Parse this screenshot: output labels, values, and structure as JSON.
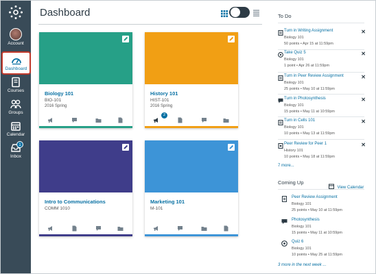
{
  "header": {
    "title": "Dashboard"
  },
  "nav": {
    "account": "Account",
    "dashboard": "Dashboard",
    "courses": "Courses",
    "groups": "Groups",
    "calendar": "Calendar",
    "inbox": "Inbox",
    "inbox_badge": "1"
  },
  "cards": [
    {
      "name": "Biology 101",
      "code": "BIO-101",
      "term": "2016 Spring",
      "color": "#26a087",
      "announcement_badge": ""
    },
    {
      "name": "History 101",
      "code": "HIST-101",
      "term": "2016 Spring",
      "color": "#f19f14",
      "announcement_badge": "2"
    },
    {
      "name": "Intro to Communications",
      "code": "COMM 1010",
      "term": "",
      "color": "#3f3d8a",
      "announcement_badge": ""
    },
    {
      "name": "Marketing 101",
      "code": "M-101",
      "term": "",
      "color": "#3d94d7",
      "announcement_badge": ""
    }
  ],
  "todo": {
    "heading": "To Do",
    "items": [
      {
        "title": "Turn in Writing Assignment",
        "course": "Biology 101",
        "details": "50 points • Apr 15 at 11:59pm",
        "icon": "assignment-icon"
      },
      {
        "title": "Take Quiz 5",
        "course": "Biology 101",
        "details": "1 point • Apr 26 at 11:59pm",
        "icon": "quiz-icon"
      },
      {
        "title": "Turn in Peer Review Assignment",
        "course": "Biology 101",
        "details": "25 points • May 10 at 11:59pm",
        "icon": "assignment-icon"
      },
      {
        "title": "Turn in Photosynthesis",
        "course": "Biology 101",
        "details": "15 points • May 11 at 10:59pm",
        "icon": "discussion-icon"
      },
      {
        "title": "Turn in Cells 101",
        "course": "Biology 101",
        "details": "10 points • May 13 at 11:59pm",
        "icon": "assignment-icon"
      },
      {
        "title": "Peer Review for Peer 1",
        "course": "History 101",
        "details": "10 points • May 18 at 11:59pm",
        "icon": "peer-review-icon"
      }
    ],
    "more": "7 more..."
  },
  "coming_up": {
    "heading": "Coming Up",
    "view_calendar": "View Calendar",
    "items": [
      {
        "title": "Peer Review Assignment",
        "course": "Biology 101",
        "details": "25 points • May 10 at 11:59pm",
        "icon": "assignment-icon"
      },
      {
        "title": "Photosynthesis",
        "course": "Biology 101",
        "details": "15 points • May 11 at 10:59pm",
        "icon": "discussion-icon"
      },
      {
        "title": "Quiz 6",
        "course": "Biology 101",
        "details": "10 points • May 25 at 11:59pm",
        "icon": "quiz-icon"
      }
    ],
    "more": "3 more in the next week ..."
  }
}
